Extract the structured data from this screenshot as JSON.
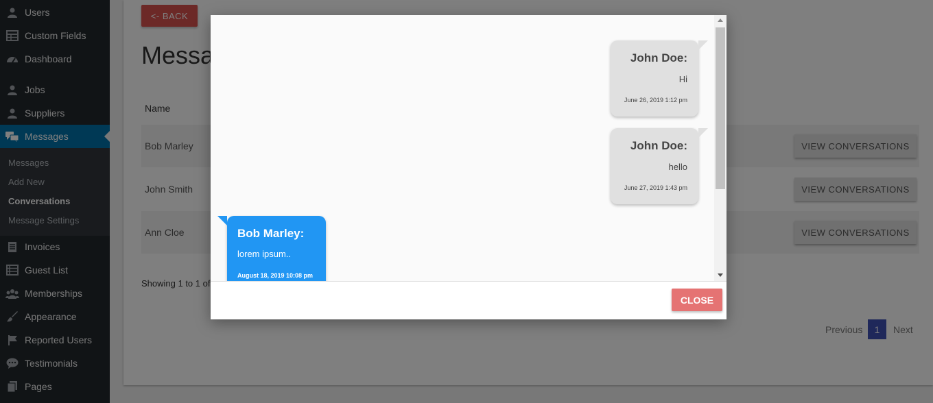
{
  "sidebar": {
    "items": [
      {
        "label": "Users",
        "icon": "user-icon"
      },
      {
        "label": "Custom Fields",
        "icon": "table-icon"
      },
      {
        "label": "Dashboard",
        "icon": "dashboard-icon"
      },
      {
        "label": "Jobs",
        "icon": "user-icon"
      },
      {
        "label": "Suppliers",
        "icon": "user-icon"
      },
      {
        "label": "Messages",
        "icon": "chat-bubbles-icon"
      },
      {
        "label": "Invoices",
        "icon": "document-icon"
      },
      {
        "label": "Guest List",
        "icon": "list-icon"
      },
      {
        "label": "Memberships",
        "icon": "groups-icon"
      },
      {
        "label": "Appearance",
        "icon": "brush-icon"
      },
      {
        "label": "Reported Users",
        "icon": "flag-icon"
      },
      {
        "label": "Testimonials",
        "icon": "speech-bubble-icon"
      },
      {
        "label": "Pages",
        "icon": "pages-icon"
      }
    ],
    "submenu": [
      "Messages",
      "Add New",
      "Conversations",
      "Message Settings"
    ]
  },
  "main": {
    "back_label": "<- BACK",
    "title": "Messages",
    "column_name": "Name",
    "rows": [
      {
        "name": "Bob Marley",
        "action": "VIEW CONVERSATIONS"
      },
      {
        "name": "John Smith",
        "action": "VIEW CONVERSATIONS"
      },
      {
        "name": "Ann Cloe",
        "action": "VIEW CONVERSATIONS"
      }
    ],
    "showing": "Showing 1 to 1 of",
    "pagination": {
      "previous": "Previous",
      "current": "1",
      "next": "Next"
    }
  },
  "modal": {
    "messages": [
      {
        "sender": "John Doe:",
        "text": "Hi",
        "time": "June 26, 2019 1:12 pm",
        "side": "right"
      },
      {
        "sender": "John Doe:",
        "text": "hello",
        "time": "June 27, 2019 1:43 pm",
        "side": "right"
      },
      {
        "sender": "Bob Marley:",
        "text": "lorem ipsum..",
        "time": "August 18, 2019 10:08 pm",
        "side": "left"
      }
    ],
    "close_label": "CLOSE"
  },
  "colors": {
    "sidebar_bg": "#23282d",
    "active_menu": "#0073aa",
    "back_button": "#d9534f",
    "close_button": "#e57373",
    "received_bubble": "#2196f3",
    "sent_bubble": "#e0e0e0",
    "page_active": "#3f51b5"
  }
}
